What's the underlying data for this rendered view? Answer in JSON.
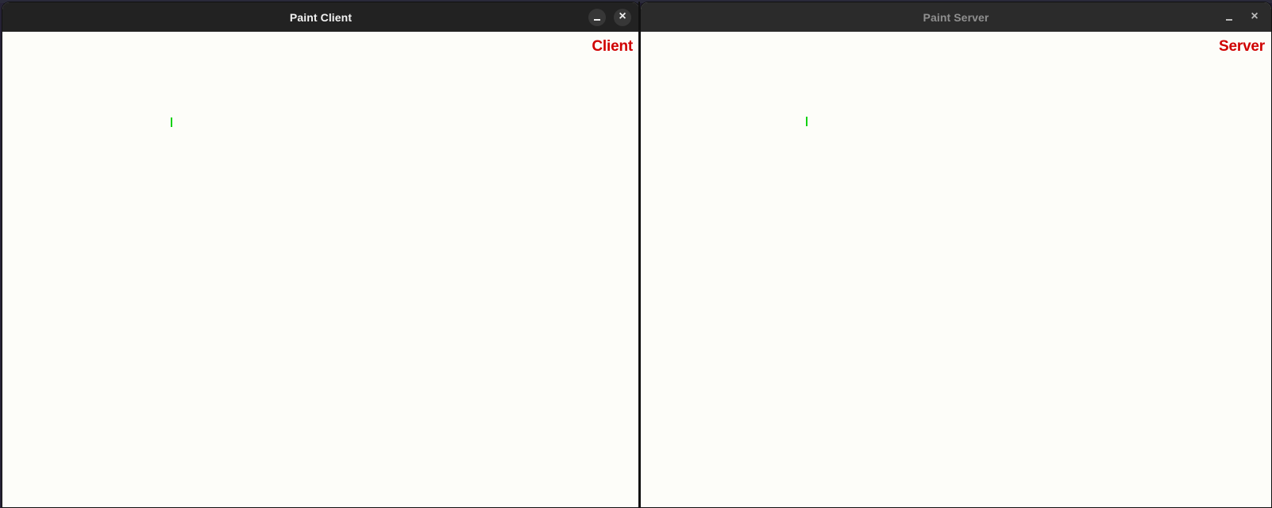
{
  "windows": {
    "client": {
      "title": "Paint Client",
      "label": "Client",
      "minimize_icon": "minimize-icon",
      "close_icon": "close-icon",
      "label_color": "#d00000",
      "stroke_color": "#12d112"
    },
    "server": {
      "title": "Paint Server",
      "label": "Server",
      "minimize_icon": "minimize-icon",
      "close_icon": "close-icon",
      "label_color": "#d00000",
      "stroke_color": "#12d112"
    }
  },
  "symbols": {
    "close": "×"
  }
}
